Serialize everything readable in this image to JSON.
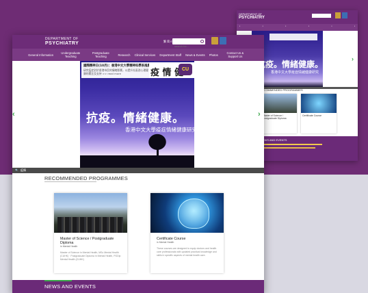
{
  "back_window": {
    "logo_line1": "DEPARTMENT OF",
    "logo_line2": "PSYCHIATRY",
    "hero_title": "抗疫。情緒健康。",
    "hero_subtitle": "香港中文大學疫症情緒健康研究",
    "recommended_title": "RECOMMENDED PROGRAMMES",
    "card1_title": "Master of Science / Postgraduate Diploma",
    "card2_title": "Certificate Course",
    "news_title": "NEWS AND EVENTS"
  },
  "header": {
    "logo_line1": "DEPARTMENT OF",
    "logo_line2": "PSYCHIATRY",
    "lang": "繁 简 EN",
    "search_placeholder": "search for..."
  },
  "nav": {
    "items": [
      {
        "label": "General Information"
      },
      {
        "label": "Undergraduate Teaching"
      },
      {
        "label": "Postgraduate Teaching"
      },
      {
        "label": "Research"
      },
      {
        "label": "Clinical Services"
      },
      {
        "label": "Department Staff"
      },
      {
        "label": "News & Events"
      },
      {
        "label": "Photos"
      },
      {
        "label": "Contact Us & Support Us"
      }
    ]
  },
  "hero": {
    "notice_title": "國際精神日(10月)：香港中文大學精神科學系推廣心理健康",
    "notice_desc": "研究疫症對於香港市民的情緒影響，以提升社區對心理健康的關注及支持 >> read more",
    "badge_text": "疫 情 健",
    "badge_mark": "CU",
    "title": "抗疫。情緒健康。",
    "subtitle": "香港中文大學疫症情緒健康研究",
    "arrow_left": "‹",
    "arrow_right": "›",
    "strip_label": "疫情"
  },
  "recommended": {
    "title": "RECOMMENDED PROGRAMMES",
    "cards": [
      {
        "title": "Master of Science / Postgraduate Diploma",
        "subtitle": "in Mental Health",
        "desc": "Master of Science in Mental Health, MSc Mental Health (CUHK) · Postgraduate Diploma in Mental Health, PGDip Mental Health (CUHK)"
      },
      {
        "title": "Certificate Course",
        "subtitle": "in Mental Health",
        "desc": "These courses are designed to equip doctors and health care professionals with updated practical knowledge and skills in specific aspects of mental health care."
      }
    ]
  },
  "news": {
    "title": "NEWS AND EVENTS"
  }
}
